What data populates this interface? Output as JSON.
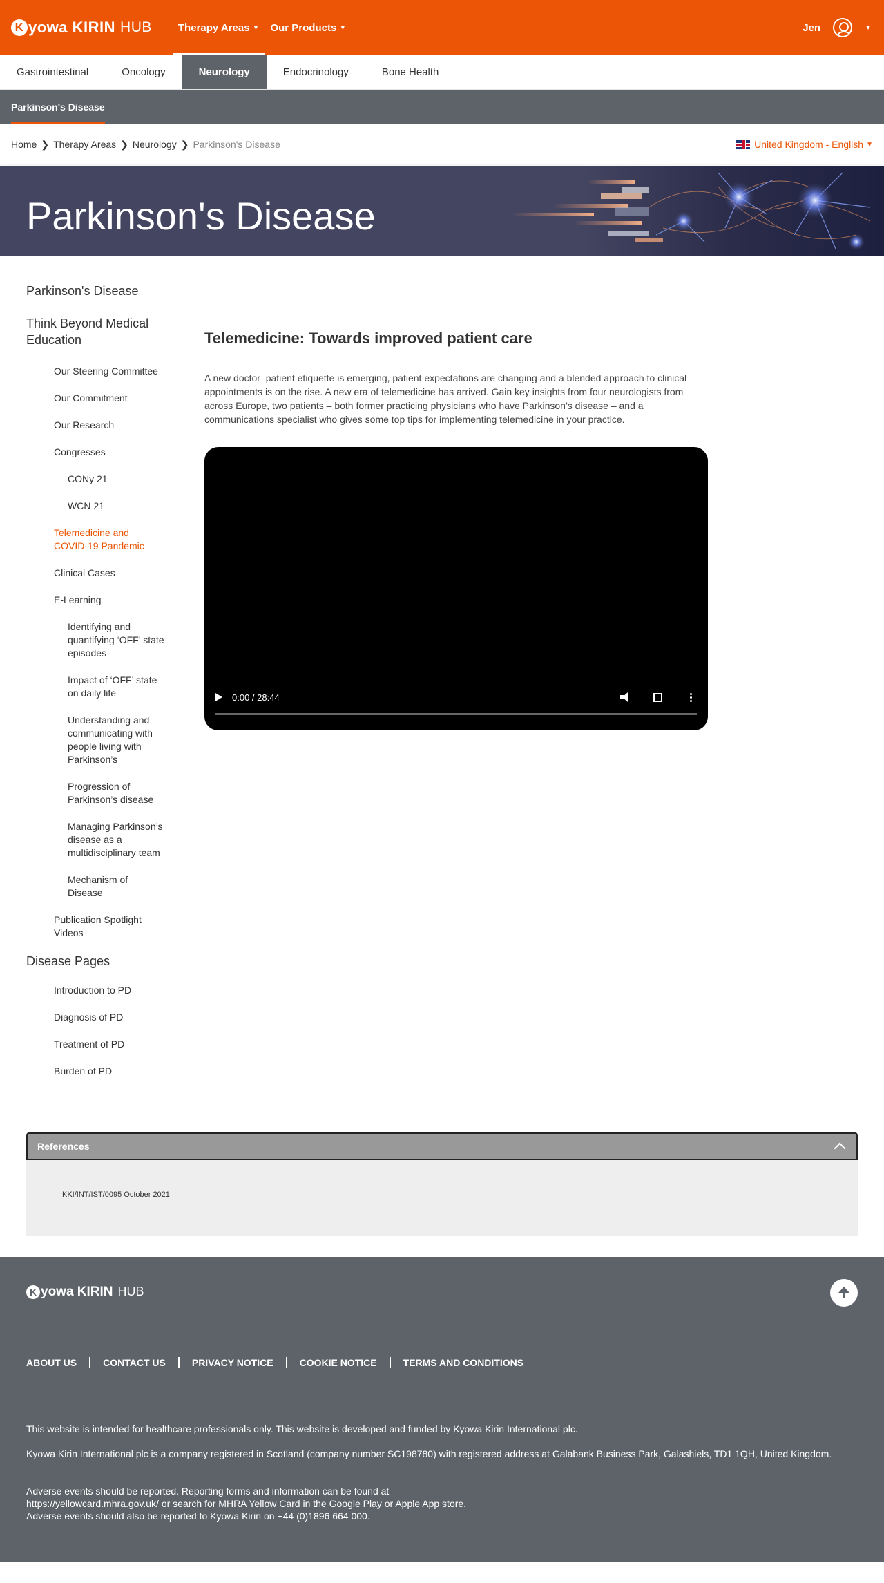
{
  "header": {
    "logo_brand": "Kyowa KIRIN",
    "logo_k": "K",
    "logo_brand_rest": "yowa KIRIN",
    "logo_hub": "HUB",
    "nav": [
      {
        "label": "Therapy Areas"
      },
      {
        "label": "Our Products"
      }
    ],
    "user_name": "Jen"
  },
  "subnav": [
    "Gastrointestinal",
    "Oncology",
    "Neurology",
    "Endocrinology",
    "Bone Health"
  ],
  "section_tab": "Parkinson's Disease",
  "breadcrumb": [
    "Home",
    "Therapy Areas",
    "Neurology",
    "Parkinson's Disease"
  ],
  "language": "United Kingdom - English",
  "hero_title": "Parkinson's Disease",
  "sidebar": {
    "top": "Parkinson's Disease",
    "think": "Think Beyond Medical Education",
    "steering": "Our Steering Committee",
    "commitment": "Our Commitment",
    "research": "Our Research",
    "congresses": "Congresses",
    "cony": "CONy 21",
    "wcn": "WCN 21",
    "telemed": "Telemedicine and COVID-19 Pandemic",
    "clinical": "Clinical Cases",
    "elearning": "E-Learning",
    "el1": "Identifying and quantifying ‘OFF’ state episodes",
    "el2": "Impact of ‘OFF’ state on daily life",
    "el3": "Understanding and communicating with people living with Parkinson’s",
    "el4": "Progression of Parkinson’s disease",
    "el5": "Managing Parkinson’s disease as a multidisciplinary team",
    "el6": "Mechanism of Disease",
    "pubs": "Publication Spotlight Videos",
    "disease_pages": "Disease Pages",
    "dp1": "Introduction to PD",
    "dp2": "Diagnosis of PD",
    "dp3": "Treatment of PD",
    "dp4": "Burden of PD"
  },
  "content": {
    "title": "Telemedicine: Towards improved patient care",
    "body": "A new doctor–patient etiquette is emerging, patient expectations are changing and a blended approach to clinical appointments is on the rise. A new era of telemedicine has arrived. Gain key insights from four neurologists from across Europe, two patients – both former practicing physicians who have Parkinson’s disease – and a communications specialist who gives some top tips for implementing telemedicine in your practice."
  },
  "video": {
    "time": "0:00 / 28:44",
    "progress": 0
  },
  "references": {
    "title": "References",
    "code": "KKI/INT/IST/0095 October 2021"
  },
  "footer": {
    "links": [
      "ABOUT US",
      "CONTACT US",
      "PRIVACY NOTICE",
      "COOKIE NOTICE",
      "TERMS AND CONDITIONS"
    ],
    "disclaimer": "This website is intended for healthcare professionals only. This website is developed and funded by Kyowa Kirin International plc.",
    "company": "Kyowa Kirin International plc is a company registered in Scotland (company number SC198780) with registered address at Galabank Business Park, Galashiels, TD1 1QH, United Kingdom.",
    "adverse1": "Adverse events should be reported. Reporting forms and information can be found at",
    "adverse2": "https://yellowcard.mhra.gov.uk/ or search for MHRA Yellow Card in the Google Play or Apple App store.",
    "adverse3": "Adverse events should also be reported to Kyowa Kirin on +44 (0)1896 664 000."
  },
  "colors": {
    "brand_orange": "#eb5505",
    "nav_grey": "#5e6369",
    "hero_navy": "#434561"
  }
}
